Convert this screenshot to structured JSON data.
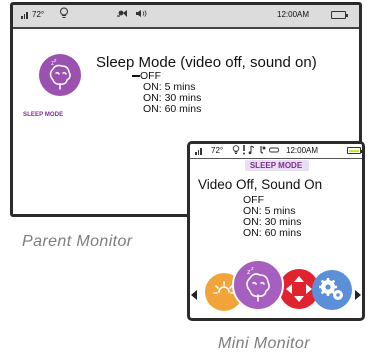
{
  "parent_monitor": {
    "status": {
      "temperature": "72°",
      "time": "12:00AM"
    },
    "sleep_mode_label": "SLEEP MODE",
    "title": "Sleep Mode (video off, sound on)",
    "options": [
      "OFF",
      "ON: 5 mins",
      "ON: 30 mins",
      "ON: 60 mins"
    ],
    "caption": "Parent Monitor"
  },
  "mini_monitor": {
    "status": {
      "temperature": "72°",
      "time": "12:00AM"
    },
    "sleep_mode_label": "SLEEP MODE",
    "title": "Video Off, Sound On",
    "options": [
      "OFF",
      "ON: 5 mins",
      "ON: 30 mins",
      "ON: 60 mins"
    ],
    "tray_icons": [
      "brightness-icon",
      "sleep-mode-icon",
      "move-icon",
      "settings-icon"
    ],
    "caption": "Mini Monitor"
  },
  "colors": {
    "sleep_purple": "#9b51b0",
    "brightness_orange": "#f0a43a",
    "move_red": "#e0232f",
    "settings_blue": "#5b8fd9",
    "battery_green": "#cde81a"
  }
}
